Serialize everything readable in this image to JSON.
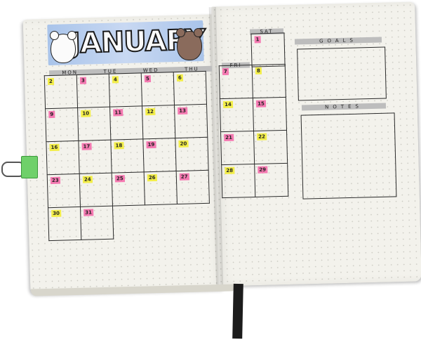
{
  "journal": {
    "month_title": "JANUARY",
    "weekday_labels": [
      "MON",
      "TUE",
      "WED",
      "THU"
    ],
    "friday_label": "FRI",
    "saturday_label": "SAT",
    "goals_label": "GOALS",
    "notes_label": "NOTES",
    "highlight_colors": {
      "yellow": "#f3ee49",
      "pink": "#f57ab2"
    },
    "banner_color": "#b6cdee",
    "left_grid_rows": [
      [
        {
          "n": "2",
          "c": "yellow"
        },
        {
          "n": "3",
          "c": "pink"
        },
        {
          "n": "4",
          "c": "yellow"
        },
        {
          "n": "5",
          "c": "pink"
        },
        {
          "n": "6",
          "c": "yellow"
        }
      ],
      [
        {
          "n": "9",
          "c": "pink"
        },
        {
          "n": "10",
          "c": "yellow"
        },
        {
          "n": "11",
          "c": "pink"
        },
        {
          "n": "12",
          "c": "yellow"
        },
        {
          "n": "13",
          "c": "pink"
        }
      ],
      [
        {
          "n": "16",
          "c": "yellow"
        },
        {
          "n": "17",
          "c": "pink"
        },
        {
          "n": "18",
          "c": "yellow"
        },
        {
          "n": "19",
          "c": "pink"
        },
        {
          "n": "20",
          "c": "yellow"
        }
      ],
      [
        {
          "n": "23",
          "c": "pink"
        },
        {
          "n": "24",
          "c": "yellow"
        },
        {
          "n": "25",
          "c": "pink"
        },
        {
          "n": "26",
          "c": "yellow"
        },
        {
          "n": "27",
          "c": "pink"
        }
      ],
      [
        {
          "n": "30",
          "c": "yellow"
        },
        {
          "n": "31",
          "c": "pink"
        }
      ]
    ],
    "right_grid_rows": [
      [
        {
          "n": "7",
          "c": "pink"
        },
        {
          "n": "8",
          "c": "yellow"
        }
      ],
      [
        {
          "n": "14",
          "c": "yellow"
        },
        {
          "n": "15",
          "c": "pink"
        }
      ],
      [
        {
          "n": "21",
          "c": "pink"
        },
        {
          "n": "22",
          "c": "yellow"
        }
      ],
      [
        {
          "n": "28",
          "c": "yellow"
        },
        {
          "n": "29",
          "c": "pink"
        }
      ]
    ],
    "saturday_top_cell": {
      "n": "1",
      "c": "pink"
    }
  }
}
